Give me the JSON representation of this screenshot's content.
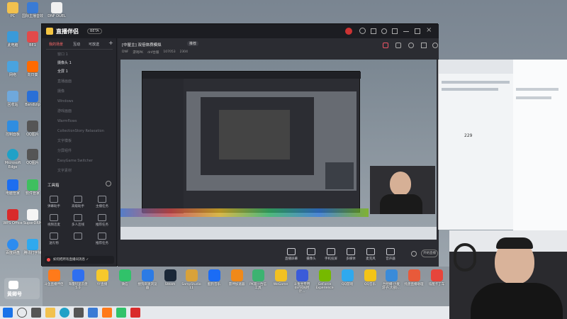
{
  "desktop_icons": [
    {
      "label": "PC",
      "color": "#f2c14e"
    },
    {
      "label": "国际主播音效",
      "color": "#3a7bd5"
    },
    {
      "label": "DNF DUEL",
      "color": "#f0f0f0"
    },
    {
      "label": "此电脑",
      "color": "#3a9ad9"
    },
    {
      "label": "BE1",
      "color": "#e24a4a"
    },
    {
      "label": "网络",
      "color": "#4aa3df"
    },
    {
      "label": "向日葵",
      "color": "#ff6a00"
    },
    {
      "label": "回收站",
      "color": "#6fa8dc"
    },
    {
      "label": "Bandizip",
      "color": "#2a6fd6"
    },
    {
      "label": "控制面板",
      "color": "#2f8de0"
    },
    {
      "label": "QQ图片",
      "color": "#555"
    },
    {
      "label": "Microsoft Edge",
      "color": "#1fa1c7"
    },
    {
      "label": "QQ图片",
      "color": "#555"
    },
    {
      "label": "电脑管家",
      "color": "#1d6ef0"
    },
    {
      "label": "软件管家",
      "color": "#3fbf5f"
    },
    {
      "label": "WPS Office",
      "color": "#d92b2b"
    },
    {
      "label": "SuperDRM",
      "color": "#f5f5f5"
    },
    {
      "label": "百度网盘",
      "color": "#2d8cf0"
    },
    {
      "label": "腾讯打字帧",
      "color": "#2fa9ee"
    }
  ],
  "app": {
    "brand": "直播伴侣",
    "version": "BETA",
    "sidebar_tabs": [
      "我的场景",
      "互动",
      "可放送"
    ],
    "sources": [
      "窗口 1",
      "摄像头 1",
      "全屏 1",
      "直播画面",
      "摄像",
      "Windows",
      "游戏画面",
      "Warmflows",
      "CollectionStory Relaxation",
      "文字模板",
      "分屏组件",
      "EasyGame Switcher",
      "文字素材"
    ],
    "toolbox_label": "工具箱",
    "tools": [
      "弹幕助手",
      "高级助手",
      "主播任务",
      "视频连麦",
      "多人连线",
      "推荐任务",
      "送礼物",
      "",
      "推荐任务"
    ],
    "notice": "如何把所有直播间消息 ✓",
    "stream_title": "[中屋主] 双倍体质模拟",
    "stream_tag": "推荐",
    "meta": [
      "DNF",
      "游戏PK",
      "dnf台服",
      "107053",
      "2304"
    ],
    "bottom_tools": [
      "直播屏幕",
      "摄像头",
      "手机投屏",
      "多媒体",
      "麦克风",
      "音声器"
    ],
    "start_button": "开始直播"
  },
  "overlay_logo": "黄卿号",
  "taskbar_apps": [
    {
      "label": "斗鱼直播伴侣",
      "color": "#ff7a1a"
    },
    {
      "label": "海量阿里云盘5.0",
      "color": "#2f6ff0"
    },
    {
      "label": "YY直播",
      "color": "#f6c92b"
    },
    {
      "label": "微信",
      "color": "#31c26a"
    },
    {
      "label": "搜狗高速浏览器",
      "color": "#2c7be5"
    },
    {
      "label": "Steam",
      "color": "#1b2838"
    },
    {
      "label": "SampStudio 11",
      "color": "#d9a23a"
    },
    {
      "label": "酷狗音乐",
      "color": "#1b6cf5"
    },
    {
      "label": "雷神加速器",
      "color": "#f0891a"
    },
    {
      "label": "PK第一台信工具",
      "color": "#3cb371"
    },
    {
      "label": "WeGame",
      "color": "#f2c122"
    },
    {
      "label": "斗鱼主专用dnf对局时计...",
      "color": "#3a5bd9"
    },
    {
      "label": "GeForce Experience",
      "color": "#76b900"
    },
    {
      "label": "QQ游戏",
      "color": "#2fa9ee"
    },
    {
      "label": "QQ音乐",
      "color": "#f3c417"
    },
    {
      "label": "台组播·小麦游子(大部)...",
      "color": "#3a8bd9"
    },
    {
      "label": "托盘直播助理",
      "color": "#e85a3a"
    },
    {
      "label": "炫酷卡丁车",
      "color": "#e7453b"
    }
  ],
  "chat_panel": {
    "number": "229"
  }
}
